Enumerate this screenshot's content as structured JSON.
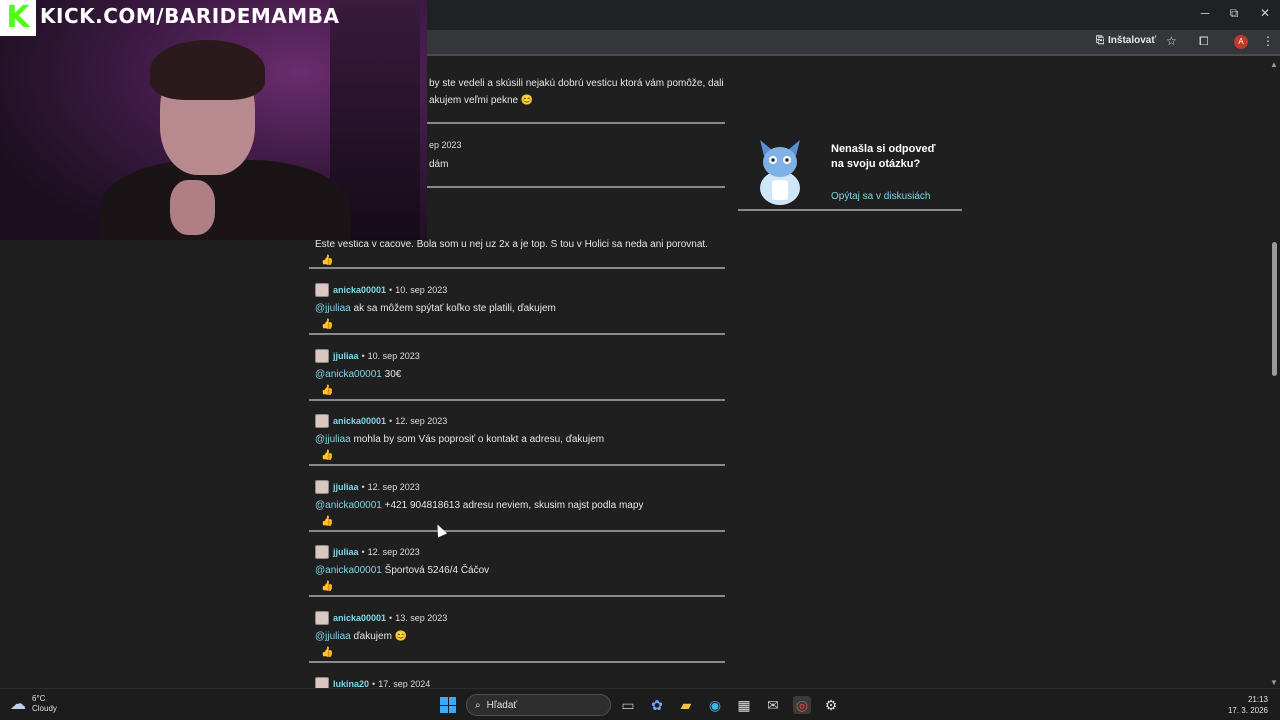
{
  "browser": {
    "window_controls": {
      "minimize": "─",
      "restore": "⧉",
      "close": "✕"
    },
    "install_label": "Inštalovať",
    "profile_initial": "A"
  },
  "overlay": {
    "channel_url": "KICK.COM/BARIDEMAMBA",
    "logo_letter": "K"
  },
  "partial_top": {
    "line1": "by ste vedeli a skúsili nejakú dobrú vesticu ktorá vám pomôže, dali",
    "line2": "akujem veľmi pekne 😊",
    "date_fragment": "ep 2023",
    "text_fragment": "dám"
  },
  "comments": [
    {
      "user": "",
      "date": "",
      "mention": "",
      "text": "Este vestica v cacove. Bola som u nej uz 2x a je top. S tou v Holici sa neda ani porovnat."
    },
    {
      "user": "anicka00001",
      "date": "10. sep 2023",
      "mention": "@jjuliaa",
      "text": "ak sa môžem spýtať koľko ste platili, ďakujem"
    },
    {
      "user": "jjuliaa",
      "date": "10. sep 2023",
      "mention": "@anicka00001",
      "text": "30€"
    },
    {
      "user": "anicka00001",
      "date": "12. sep 2023",
      "mention": "@jjuliaa",
      "text": "mohla by som Vás poprosiť o kontakt a adresu, ďakujem"
    },
    {
      "user": "jjuliaa",
      "date": "12. sep 2023",
      "mention": "@anicka00001",
      "text": "+421 904818613 adresu neviem, skusim najst podla mapy"
    },
    {
      "user": "jjuliaa",
      "date": "12. sep 2023",
      "mention": "@anicka00001",
      "text": "Športová 5246/4 Čáčov"
    },
    {
      "user": "anicka00001",
      "date": "13. sep 2023",
      "mention": "@jjuliaa",
      "text": "ďakujem 😊"
    },
    {
      "user": "lukina20",
      "date": "17. sep 2024",
      "mention": "",
      "text": ""
    }
  ],
  "like_icon": "👍",
  "side_card": {
    "title": "Nenašla si odpoveď na svoju otázku?",
    "link": "Opýtaj sa v diskusiách"
  },
  "taskbar": {
    "temperature": "6°C",
    "condition": "Cloudy",
    "search_placeholder": "Hľadať",
    "time": "21:13",
    "date": "17. 3. 2026"
  }
}
